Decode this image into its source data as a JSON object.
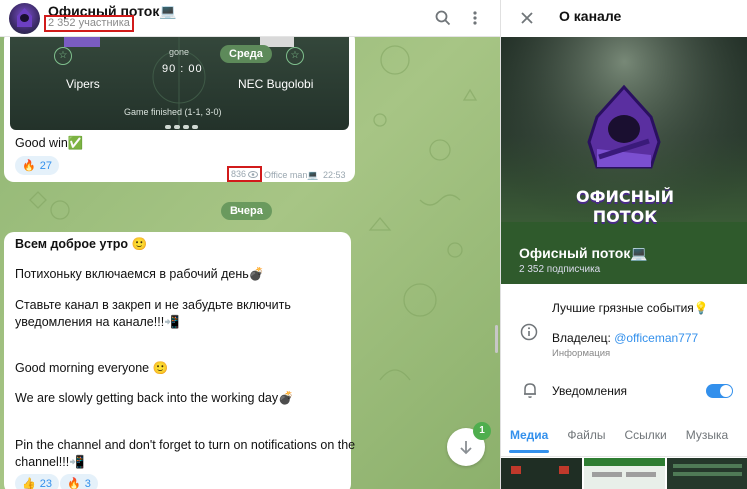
{
  "chat": {
    "title": "Офисный поток💻",
    "members": "2 352 участника",
    "match": {
      "team_left": "Vipers",
      "team_right": "NEC Bugolobi",
      "status": "gone",
      "score": "90 : 00",
      "result": "Game finished (1-1, 3-0)",
      "day_badge": "Среда"
    },
    "msg1": {
      "text": "Good win✅",
      "reaction_emoji": "🔥",
      "reaction_count": "27",
      "views": "836",
      "author": "Office man💻",
      "time": "22:53"
    },
    "day_divider": "Вчера",
    "msg2": {
      "lines": [
        "Всем доброе утро 🙂",
        "Потихоньку включаемся в рабочий день💣",
        "Ставьте канал в закреп и не забудьте включить",
        "уведомления на канале!!!📲",
        "Good morning everyone 🙂",
        "We are slowly getting back into the working day💣",
        "Pin the channel and don't forget to turn on notifications on the",
        "channel!!!📲"
      ],
      "reaction1_emoji": "👍",
      "reaction1_count": "23",
      "reaction2_emoji": "🔥",
      "reaction2_count": "3"
    },
    "unread_count": "1"
  },
  "panel": {
    "title": "О канале",
    "logo_text_line1": "ОФИСНЫЙ",
    "logo_text_line2": "ПОТОК",
    "channel_name": "Офисный поток💻",
    "subscribers": "2 352 подписчика",
    "description": "Лучшие грязные события💡",
    "owner_prefix": "Владелец: ",
    "owner_link": "@officeman777",
    "info_label": "Информация",
    "notifications_label": "Уведомления",
    "notifications_on": true,
    "tabs": [
      "Медиа",
      "Файлы",
      "Ссылки",
      "Музыка",
      "Г"
    ]
  },
  "colors": {
    "accent": "#3390ec",
    "highlight_box": "#d11b1b",
    "chat_bg": "#9dbc7c"
  }
}
